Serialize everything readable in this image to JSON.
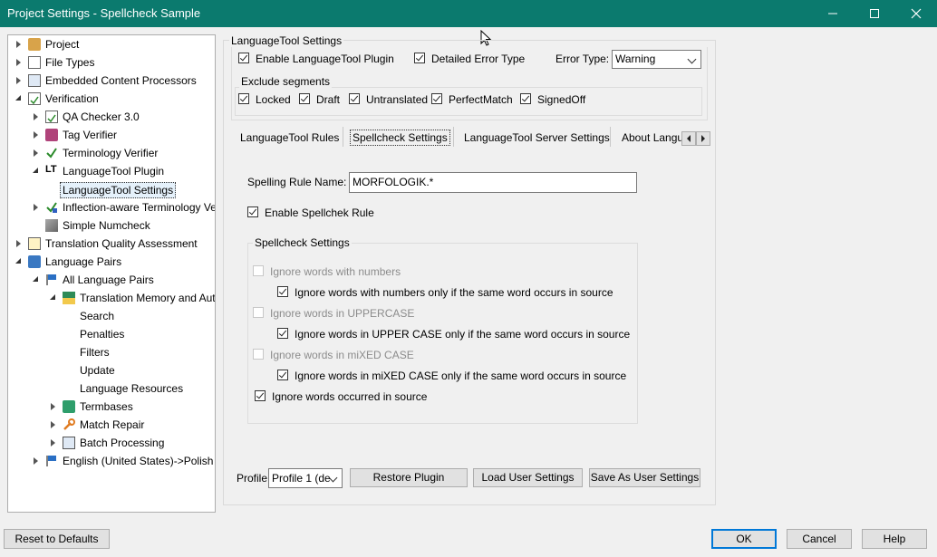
{
  "window": {
    "title": "Project Settings - Spellcheck Sample"
  },
  "tree": {
    "project": "Project",
    "file_types": "File Types",
    "embedded": "Embedded Content Processors",
    "verification": "Verification",
    "qa_checker": "QA Checker 3.0",
    "tag_verifier": "Tag Verifier",
    "terminology_verifier": "Terminology Verifier",
    "languagetool_plugin": "LanguageTool Plugin",
    "languagetool_settings": "LanguageTool Settings",
    "inflection": "Inflection-aware Terminology Ver",
    "simple_numcheck": "Simple Numcheck",
    "tqa": "Translation Quality Assessment",
    "language_pairs": "Language Pairs",
    "all_language_pairs": "All Language Pairs",
    "tm_auto": "Translation Memory and Auto",
    "search": "Search",
    "penalties": "Penalties",
    "filters": "Filters",
    "update": "Update",
    "language_resources": "Language Resources",
    "termbases": "Termbases",
    "match_repair": "Match Repair",
    "batch_processing": "Batch Processing",
    "english_polish": "English (United States)->Polish (P"
  },
  "settings": {
    "group_title": "LanguageTool Settings",
    "enable_plugin": "Enable LanguageTool Plugin",
    "detailed_error": "Detailed Error Type",
    "error_type_label": "Error Type:",
    "error_type_value": "Warning",
    "exclude_title": "Exclude segments",
    "exclude": {
      "locked": "Locked",
      "draft": "Draft",
      "untranslated": "Untranslated",
      "perfectmatch": "PerfectMatch",
      "signedoff": "SignedOff"
    }
  },
  "tabs": {
    "rules": "LanguageTool Rules",
    "spellcheck": "Spellcheck Settings",
    "server": "LanguageTool Server Settings",
    "about": "About Langu"
  },
  "spellcheck": {
    "rule_name_label": "Spelling Rule Name:",
    "rule_name_value": "MORFOLOGIK.*",
    "enable_rule": "Enable Spellchek Rule",
    "group_title": "Spellcheck Settings",
    "ignore_numbers": "Ignore words with numbers",
    "ignore_numbers_source": "Ignore words with numbers only if the same word occurs in source",
    "ignore_upper": "Ignore words in UPPERCASE",
    "ignore_upper_source": "Ignore words in UPPER CASE only if the same word occurs in source",
    "ignore_mixed": "Ignore words in miXED CASE",
    "ignore_mixed_source": "Ignore words in miXED CASE only if the same word occurs in source",
    "ignore_source": "Ignore words occurred in source"
  },
  "profile": {
    "label": "Profile:",
    "value": "Profile 1 (de",
    "restore": "Restore Plugin",
    "load": "Load User Settings",
    "save": "Save As User Settings"
  },
  "footer": {
    "reset": "Reset to Defaults",
    "ok": "OK",
    "cancel": "Cancel",
    "help": "Help"
  },
  "colors": {
    "titlebar": "#0b7a6e",
    "accent": "#0078d7"
  }
}
